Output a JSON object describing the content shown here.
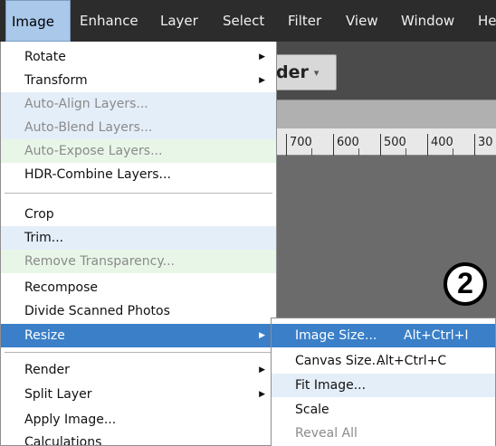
{
  "menubar": {
    "items": [
      "Image",
      "Enhance",
      "Layer",
      "Select",
      "Filter",
      "View",
      "Window",
      "He"
    ],
    "active_index": 0
  },
  "mode_button": {
    "label": "der"
  },
  "ruler": {
    "labels": [
      "700",
      "600",
      "500",
      "400",
      "30"
    ]
  },
  "step_badge": "2",
  "image_menu": {
    "items": [
      {
        "label": "Rotate",
        "submenu": true,
        "enabled": true
      },
      {
        "label": "Transform",
        "submenu": true,
        "enabled": true
      },
      {
        "label": "Auto-Align Layers...",
        "submenu": false,
        "enabled": false
      },
      {
        "label": "Auto-Blend Layers...",
        "submenu": false,
        "enabled": false
      },
      {
        "label": "Auto-Expose Layers...",
        "submenu": false,
        "enabled": false
      },
      {
        "label": "HDR-Combine Layers...",
        "submenu": false,
        "enabled": true
      },
      {
        "label": "Crop",
        "submenu": false,
        "enabled": true
      },
      {
        "label": "Trim...",
        "submenu": false,
        "enabled": true
      },
      {
        "label": "Remove Transparency...",
        "submenu": false,
        "enabled": false
      },
      {
        "label": "Recompose",
        "submenu": false,
        "enabled": true
      },
      {
        "label": "Divide Scanned Photos",
        "submenu": false,
        "enabled": true
      },
      {
        "label": "Resize",
        "submenu": true,
        "enabled": true,
        "selected": true
      },
      {
        "label": "Render",
        "submenu": true,
        "enabled": true
      },
      {
        "label": "Split Layer",
        "submenu": true,
        "enabled": true
      },
      {
        "label": "Apply Image...",
        "submenu": false,
        "enabled": true
      },
      {
        "label": "Calculations",
        "submenu": false,
        "enabled": true
      }
    ]
  },
  "resize_submenu": {
    "items": [
      {
        "label": "Image Size...",
        "shortcut": "Alt+Ctrl+I",
        "enabled": true,
        "selected": true
      },
      {
        "label": "Canvas Size...",
        "shortcut": "Alt+Ctrl+C",
        "enabled": true
      },
      {
        "label": "Fit Image...",
        "shortcut": "",
        "enabled": true
      },
      {
        "label": "Scale",
        "shortcut": "",
        "enabled": true
      },
      {
        "label": "Reveal All",
        "shortcut": "",
        "enabled": false
      }
    ]
  },
  "icons": {
    "submenu_arrow": "right-triangle-icon",
    "dropdown_caret": "caret-down-icon"
  }
}
